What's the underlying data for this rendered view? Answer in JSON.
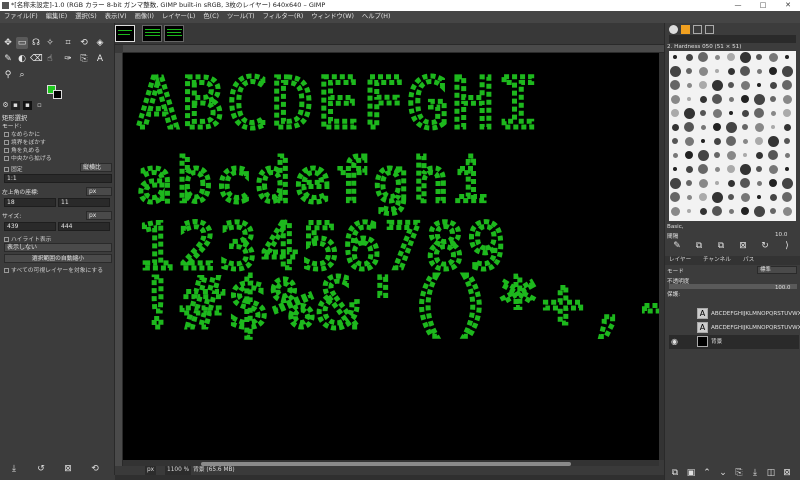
{
  "window": {
    "title": "*[名称未設定]-1.0 (RGB カラー 8-bit ガンマ整数, GIMP built-in sRGB, 3枚のレイヤー) 640x640 – GIMP",
    "minimize": "—",
    "maximize": "□",
    "close": "✕"
  },
  "menubar": [
    "ファイル(F)",
    "編集(E)",
    "選択(S)",
    "表示(V)",
    "画像(I)",
    "レイヤー(L)",
    "色(C)",
    "ツール(T)",
    "フィルター(R)",
    "ウィンドウ(W)",
    "ヘルプ(H)"
  ],
  "toolbox": {
    "tools": [
      "move-icon",
      "rect-select-icon",
      "lasso-icon",
      "fuzzy-select-icon",
      "crop-icon",
      "transform-icon",
      "warp-icon",
      "text-icon",
      "paint-icon",
      "bucket-icon",
      "eraser-icon",
      "smudge-icon",
      "path-icon",
      "clone-icon",
      "color-picker-icon",
      "zoom-icon"
    ],
    "colors": {
      "foreground": "#1ec91e",
      "background": "#000000"
    },
    "options_title": "矩形選択",
    "mode_label": "モード:",
    "antialias": "なめらかに",
    "feather": "境界をぼかす",
    "rounded": "角を丸める",
    "expand_center": "中央から拡げる",
    "fixed_label": "固定",
    "fixed_value": "縦横比",
    "ratio": "1:1",
    "position_label": "左上角の座標:",
    "position_unit": "px",
    "pos_x": "18",
    "pos_y": "11",
    "size_label": "サイズ:",
    "size_unit": "px",
    "size_w": "439",
    "size_h": "444",
    "highlight": "ハイライト表示",
    "guides": "表示しない",
    "autoshrink": "選択範囲の自動縮小",
    "merged": "すべての可視レイヤーを対象にする"
  },
  "canvas": {
    "text_color": "#1db81d",
    "rows": [
      "ABCDEFGHI",
      "abcdefghi",
      "123456789",
      "!#$%&'()*+,-./"
    ]
  },
  "status": {
    "unit": "px",
    "zoom": "1100 %",
    "info": "背景 (65.6 MB)"
  },
  "dock": {
    "brush_name": "2. Hardness 050 (51 × 51)",
    "brush_tag": "Basic,",
    "spacing_label": "間隔",
    "spacing_value": "10.0",
    "tabs": [
      "レイヤー",
      "チャンネル",
      "パス"
    ],
    "mode_label": "モード",
    "mode_value": "標準",
    "opacity_label": "不透明度",
    "opacity_value": "100.0",
    "lock_label": "保護:",
    "layers": [
      {
        "name": "ABCDEFGHIJKLMNOPQRSTUVWXY",
        "visible": false,
        "type": "text"
      },
      {
        "name": "ABCDEFGHIJKLMNOPQRSTUVWXY",
        "visible": false,
        "type": "text"
      },
      {
        "name": "背景",
        "visible": true,
        "type": "raster"
      }
    ]
  }
}
